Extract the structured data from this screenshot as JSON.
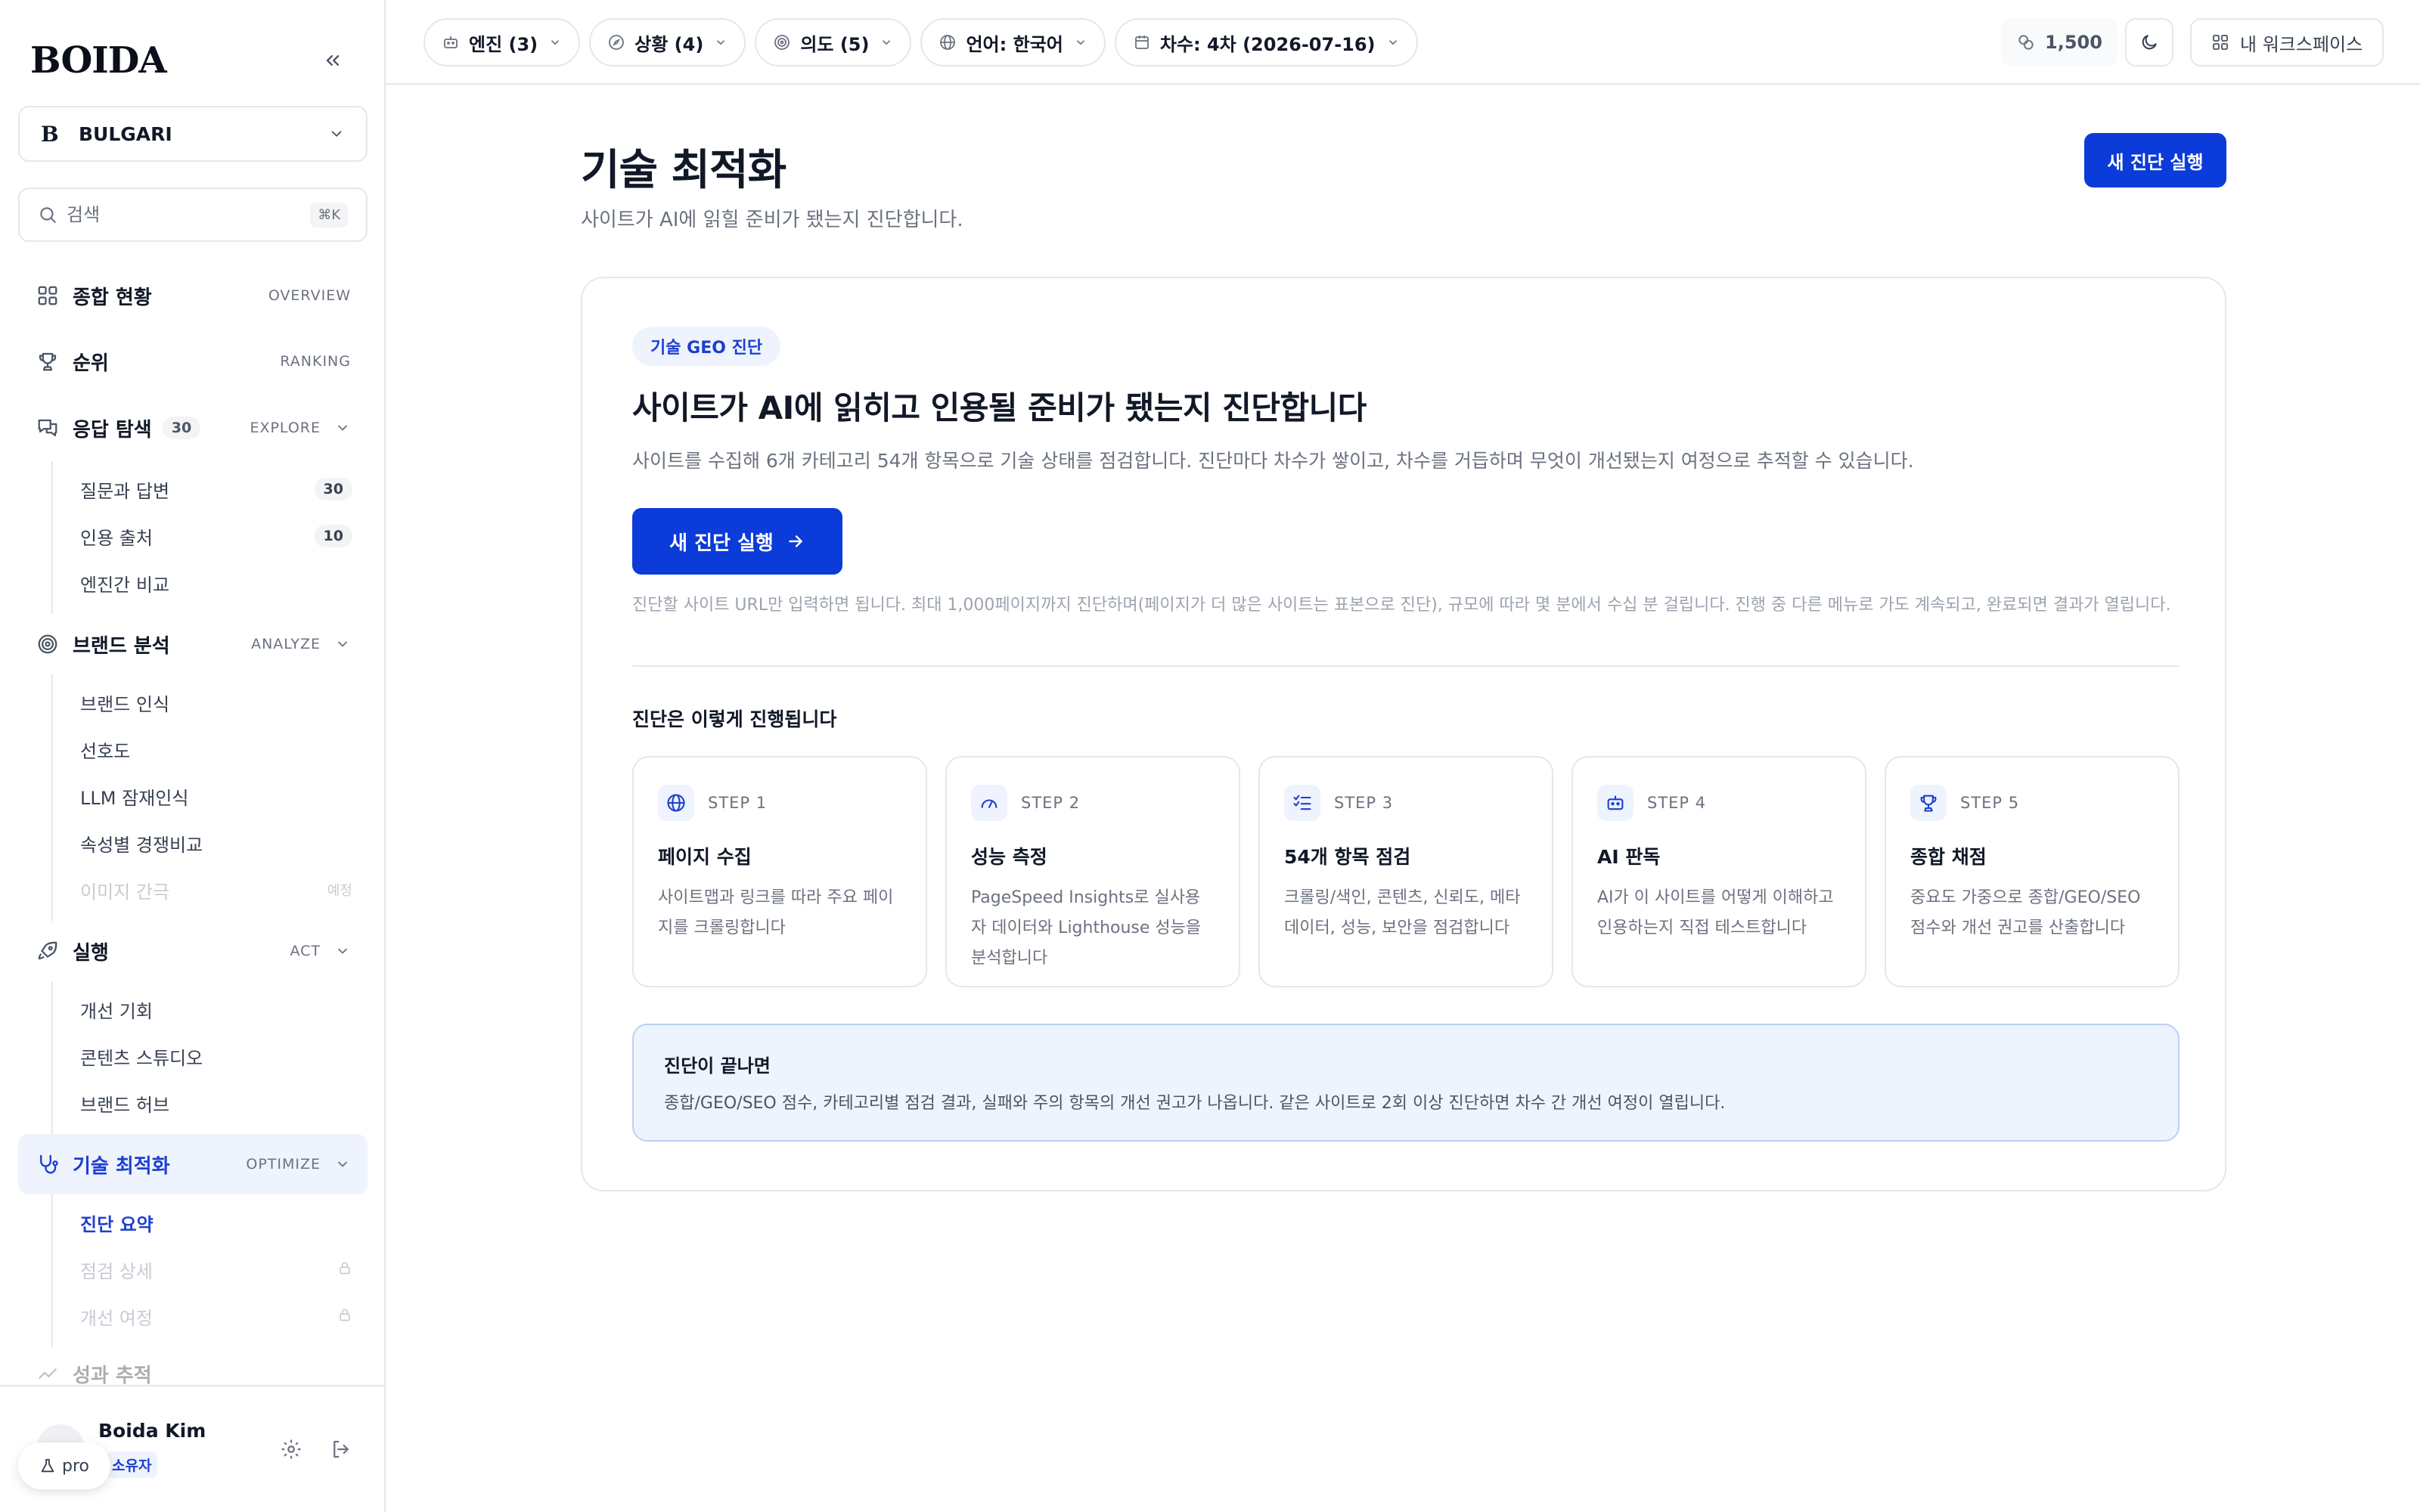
{
  "app": {
    "logo": "BOIDA",
    "brand_letter": "B",
    "brand_name": "BULGARI"
  },
  "search": {
    "placeholder": "검색",
    "shortcut": "⌘K"
  },
  "nav": {
    "overview": {
      "label": "종합 현황",
      "en": "OVERVIEW",
      "icon": "grid-icon"
    },
    "ranking": {
      "label": "순위",
      "en": "RANKING",
      "icon": "trophy-icon"
    },
    "explore": {
      "label": "응답 탐색",
      "count": "30",
      "en": "EXPLORE",
      "icon": "chat-icon",
      "items": [
        {
          "label": "질문과 답변",
          "count": "30"
        },
        {
          "label": "인용 출처",
          "count": "10"
        },
        {
          "label": "엔진간 비교"
        }
      ]
    },
    "analyze": {
      "label": "브랜드 분석",
      "en": "ANALYZE",
      "icon": "target-icon",
      "items": [
        {
          "label": "브랜드 인식"
        },
        {
          "label": "선호도"
        },
        {
          "label": "LLM 잠재인식"
        },
        {
          "label": "속성별 경쟁비교"
        },
        {
          "label": "이미지 간극",
          "note": "예정"
        }
      ]
    },
    "act": {
      "label": "실행",
      "en": "ACT",
      "icon": "rocket-icon",
      "items": [
        {
          "label": "개선 기회"
        },
        {
          "label": "콘텐츠 스튜디오"
        },
        {
          "label": "브랜드 허브"
        }
      ]
    },
    "optimize": {
      "label": "기술 최적화",
      "en": "OPTIMIZE",
      "icon": "stethoscope-icon",
      "items": [
        {
          "label": "진단 요약"
        },
        {
          "label": "점검 상세"
        },
        {
          "label": "개선 여정"
        }
      ]
    },
    "partial": {
      "label": "성과 추적"
    }
  },
  "user": {
    "name": "Boida Kim",
    "role": "소유자",
    "plan": "pro"
  },
  "filters": [
    {
      "label": "엔진 (3)",
      "icon": "robot-icon"
    },
    {
      "label": "상황 (4)",
      "icon": "compass-icon"
    },
    {
      "label": "의도 (5)",
      "icon": "target-icon"
    },
    {
      "label": "언어: 한국어",
      "icon": "globe-icon"
    },
    {
      "label": "차수: 4차 (2026-07-16)",
      "icon": "calendar-icon"
    }
  ],
  "topbar": {
    "credits": "1,500",
    "workspace": "내 워크스페이스"
  },
  "page": {
    "title": "기술 최적화",
    "subtitle": "사이트가 AI에 읽힐 준비가 됐는지 진단합니다.",
    "new_run": "새 진단 실행"
  },
  "card": {
    "tag": "기술 GEO 진단",
    "title": "사이트가 AI에 읽히고 인용될 준비가 됐는지 진단합니다",
    "desc": "사이트를 수집해 6개 카테고리 54개 항목으로 기술 상태를 점검합니다. 진단마다 차수가 쌓이고, 차수를 거듭하며 무엇이 개선됐는지 여정으로 추적할 수 있습니다.",
    "run_button": "새 진단 실행",
    "note": "진단할 사이트 URL만 입력하면 됩니다. 최대 1,000페이지까지 진단하며(페이지가 더 많은 사이트는 표본으로 진단), 규모에 따라 몇 분에서 수십 분 걸립니다. 진행 중 다른 메뉴로 가도 계속되고, 완료되면 결과가 열립니다.",
    "process_title": "진단은 이렇게 진행됩니다",
    "steps": [
      {
        "num": "STEP 1",
        "title": "페이지 수집",
        "desc": "사이트맵과 링크를 따라 주요 페이지를 크롤링합니다",
        "icon": "globe-icon"
      },
      {
        "num": "STEP 2",
        "title": "성능 측정",
        "desc": "PageSpeed Insights로 실사용자 데이터와 Lighthouse 성능을 분석합니다",
        "icon": "gauge-icon"
      },
      {
        "num": "STEP 3",
        "title": "54개 항목 점검",
        "desc": "크롤링/색인, 콘텐츠, 신뢰도, 메타데이터, 성능, 보안을 점검합니다",
        "icon": "checklist-icon"
      },
      {
        "num": "STEP 4",
        "title": "AI 판독",
        "desc": "AI가 이 사이트를 어떻게 이해하고 인용하는지 직접 테스트합니다",
        "icon": "robot-icon"
      },
      {
        "num": "STEP 5",
        "title": "종합 채점",
        "desc": "중요도 가중으로 종합/GEO/SEO 점수와 개선 권고를 산출합니다",
        "icon": "trophy-icon"
      }
    ],
    "info_title": "진단이 끝나면",
    "info_desc": "종합/GEO/SEO 점수, 카테고리별 점검 결과, 실패와 주의 항목의 개선 권고가 나옵니다. 같은 사이트로 2회 이상 진단하면 차수 간 개선 여정이 열립니다."
  },
  "colors": {
    "primary": "#0b3bd8",
    "active_bg": "#eef3fd",
    "active_text": "#1d3fcf",
    "info_bg": "#eef4fd",
    "border": "#e5e7eb"
  }
}
